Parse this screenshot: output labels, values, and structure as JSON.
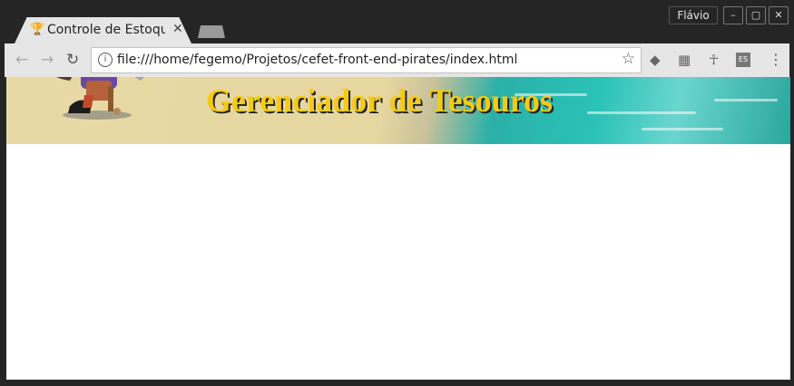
{
  "browser": {
    "tab": {
      "title": "Controle de Estoque",
      "favicon": "trophy-icon"
    },
    "profile_name": "Flávio",
    "window_controls": {
      "minimize": "–",
      "maximize": "▢",
      "close": "✕"
    },
    "address_bar": {
      "url": "file:///home/fegemo/Projetos/cefet-front-end-pirates/index.html"
    },
    "extensions": [
      "layers-icon",
      "film-icon",
      "ankh-icon",
      "es-icon"
    ],
    "extension_es_label": "ES"
  },
  "page": {
    "banner_title": "Gerenciador de Tesouros"
  },
  "colors": {
    "chrome_dark": "#252525",
    "toolbar": "#e6e6e6",
    "title_gold": "#f4cb12",
    "sea_teal": "#2bc2b7",
    "sand": "#e7d9a6"
  }
}
